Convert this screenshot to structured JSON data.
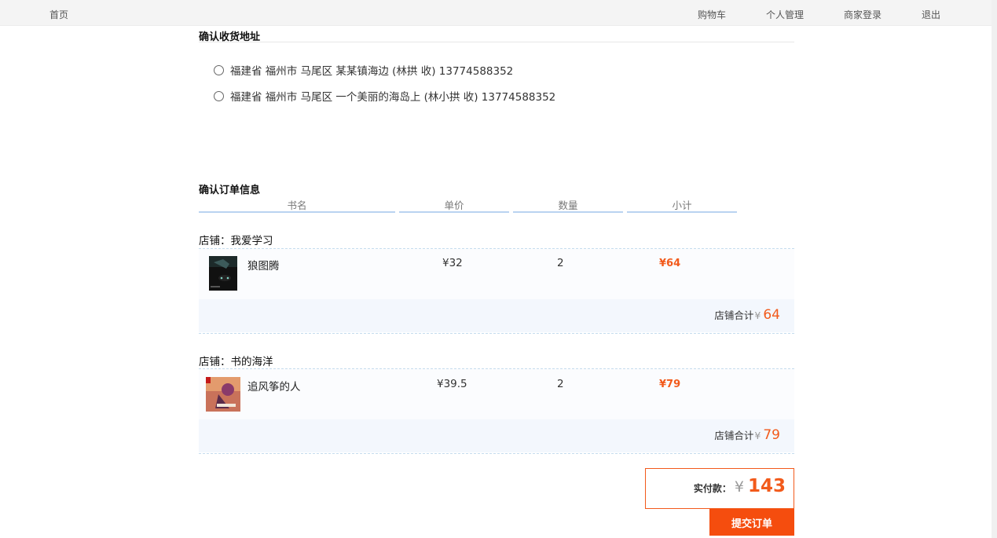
{
  "nav": {
    "home": "首页",
    "cart": "购物车",
    "account": "个人管理",
    "merchant_login": "商家登录",
    "logout": "退出"
  },
  "address_section": {
    "title": "确认收货地址",
    "addresses": [
      {
        "text": "福建省 福州市 马尾区 某某镇海边 (林拱 收) 13774588352"
      },
      {
        "text": "福建省 福州市 马尾区 一个美丽的海岛上 (林小拱 收) 13774588352"
      }
    ]
  },
  "order_section": {
    "title": "确认订单信息",
    "columns": [
      "书名",
      "单价",
      "数量",
      "小计"
    ],
    "shops": [
      {
        "name": "店铺：我爱学习",
        "items": [
          {
            "title": "狼图腾",
            "price": "¥32",
            "qty": "2",
            "subtotal": "¥64"
          }
        ],
        "total_label": "店铺合计",
        "total_currency": "¥",
        "total_value": "64"
      },
      {
        "name": "店铺：书的海洋",
        "items": [
          {
            "title": "追风筝的人",
            "price": "¥39.5",
            "qty": "2",
            "subtotal": "¥79"
          }
        ],
        "total_label": "店铺合计",
        "total_currency": "¥",
        "total_value": "79"
      }
    ]
  },
  "payment": {
    "label": "实付款：",
    "currency": "¥",
    "amount": "143"
  },
  "submit_label": "提交订单",
  "colors": {
    "accent": "#f25a1b",
    "submit_bg": "#f54d0e",
    "header_underline": "#b9d3f0",
    "row_bg": "#f3f7fd"
  }
}
